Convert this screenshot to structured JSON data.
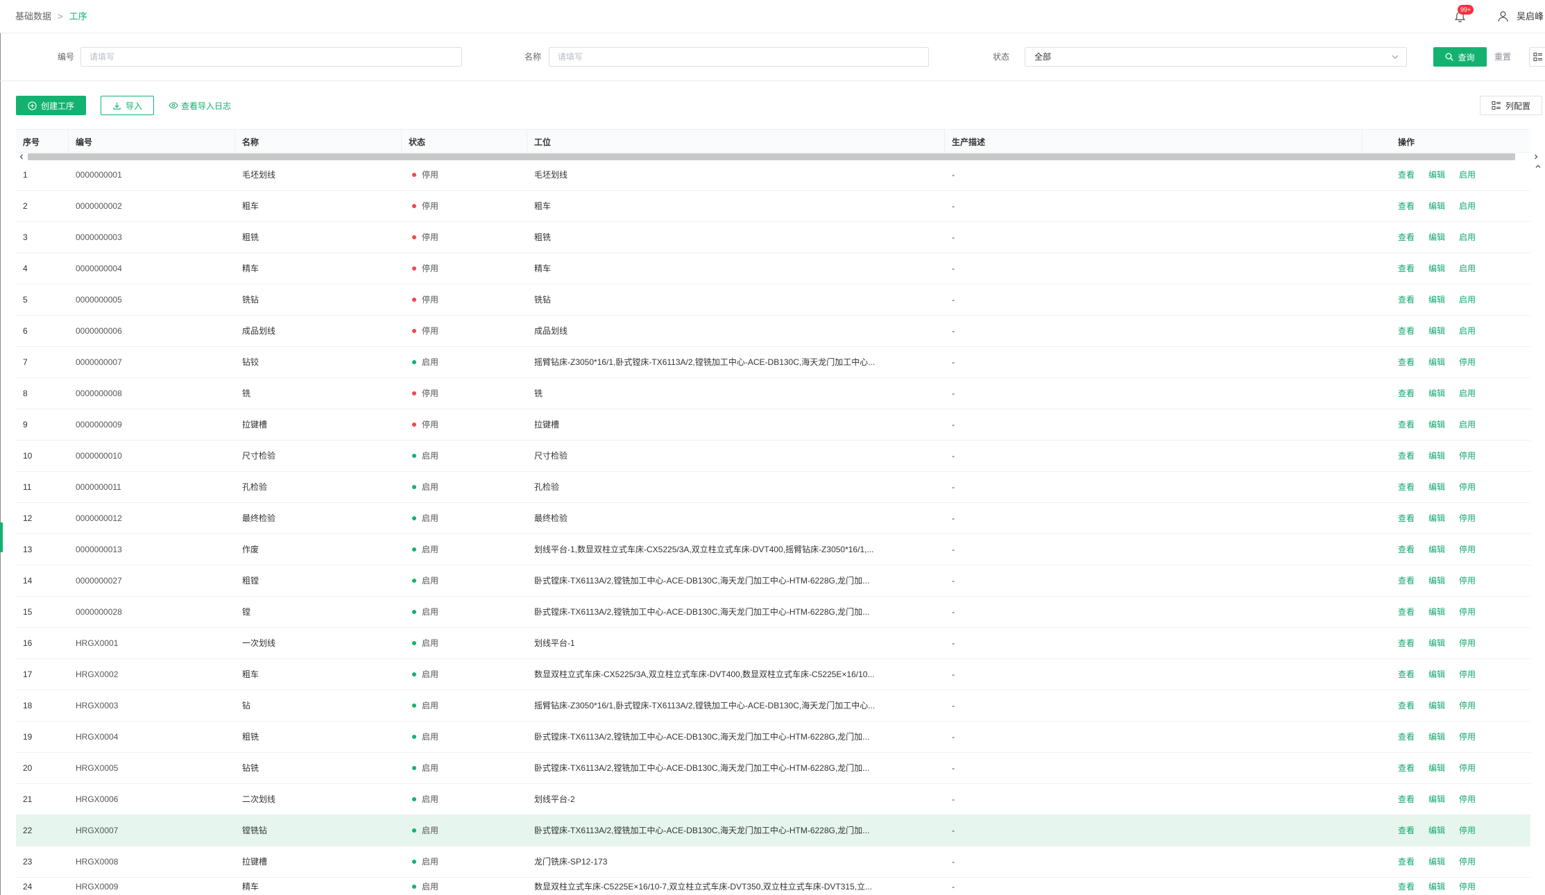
{
  "breadcrumb": {
    "parent": "基础数据",
    "separator": ">",
    "current": "工序"
  },
  "header": {
    "notification_count": "99+",
    "user_name": "吴启峰"
  },
  "filters": {
    "code_label": "编号",
    "code_placeholder": "请填写",
    "name_label": "名称",
    "name_placeholder": "请填写",
    "status_label": "状态",
    "status_value": "全部",
    "query_label": "查询",
    "reset_label": "重置"
  },
  "toolbar": {
    "create_label": "创建工序",
    "import_label": "导入",
    "log_label": "查看导入日志",
    "columns_label": "列配置"
  },
  "colors": {
    "primary": "#13b270",
    "link": "#13a86e",
    "row_highlight": "#e6f6ee",
    "badge": "#f5313d"
  },
  "status_colors": {
    "启用": "#13b270",
    "停用": "#f04848"
  },
  "icons": {
    "notification": "bell-icon",
    "user": "user-icon",
    "query": "search-icon",
    "select": "chevron-down-icon",
    "create": "plus-circle-icon",
    "import": "download-icon",
    "log": "eye-icon",
    "columns": "column-settings-icon"
  },
  "table": {
    "columns": [
      "序号",
      "编号",
      "名称",
      "状态",
      "工位",
      "生产描述",
      "操作"
    ],
    "rows": [
      {
        "no": "1",
        "code": "0000000001",
        "name": "毛坯划线",
        "status": "停用",
        "station": "毛坯划线",
        "desc": "-",
        "actions": [
          "查看",
          "编辑",
          "启用"
        ]
      },
      {
        "no": "2",
        "code": "0000000002",
        "name": "粗车",
        "status": "停用",
        "station": "粗车",
        "desc": "-",
        "actions": [
          "查看",
          "编辑",
          "启用"
        ]
      },
      {
        "no": "3",
        "code": "0000000003",
        "name": "粗铣",
        "status": "停用",
        "station": "粗铣",
        "desc": "-",
        "actions": [
          "查看",
          "编辑",
          "启用"
        ]
      },
      {
        "no": "4",
        "code": "0000000004",
        "name": "精车",
        "status": "停用",
        "station": "精车",
        "desc": "-",
        "actions": [
          "查看",
          "编辑",
          "启用"
        ]
      },
      {
        "no": "5",
        "code": "0000000005",
        "name": "铣钻",
        "status": "停用",
        "station": "铣钻",
        "desc": "-",
        "actions": [
          "查看",
          "编辑",
          "启用"
        ]
      },
      {
        "no": "6",
        "code": "0000000006",
        "name": "成品划线",
        "status": "停用",
        "station": "成品划线",
        "desc": "-",
        "actions": [
          "查看",
          "编辑",
          "启用"
        ]
      },
      {
        "no": "7",
        "code": "0000000007",
        "name": "钻铰",
        "status": "启用",
        "station": "摇臂钻床-Z3050*16/1,卧式镗床-TX6113A/2,镗铣加工中心-ACE-DB130C,海天龙门加工中心...",
        "desc": "-",
        "actions": [
          "查看",
          "编辑",
          "停用"
        ]
      },
      {
        "no": "8",
        "code": "0000000008",
        "name": "铣",
        "status": "停用",
        "station": "铣",
        "desc": "-",
        "actions": [
          "查看",
          "编辑",
          "启用"
        ]
      },
      {
        "no": "9",
        "code": "0000000009",
        "name": "拉键槽",
        "status": "停用",
        "station": "拉键槽",
        "desc": "-",
        "actions": [
          "查看",
          "编辑",
          "启用"
        ]
      },
      {
        "no": "10",
        "code": "0000000010",
        "name": "尺寸检验",
        "status": "启用",
        "station": "尺寸检验",
        "desc": "-",
        "actions": [
          "查看",
          "编辑",
          "停用"
        ]
      },
      {
        "no": "11",
        "code": "0000000011",
        "name": "孔检验",
        "status": "启用",
        "station": "孔检验",
        "desc": "-",
        "actions": [
          "查看",
          "编辑",
          "停用"
        ]
      },
      {
        "no": "12",
        "code": "0000000012",
        "name": "最终检验",
        "status": "启用",
        "station": "最终检验",
        "desc": "-",
        "actions": [
          "查看",
          "编辑",
          "停用"
        ]
      },
      {
        "no": "13",
        "code": "0000000013",
        "name": "作废",
        "status": "启用",
        "station": "划线平台-1,数显双柱立式车床-CX5225/3A,双立柱立式车床-DVT400,摇臂钻床-Z3050*16/1,...",
        "desc": "-",
        "actions": [
          "查看",
          "编辑",
          "停用"
        ]
      },
      {
        "no": "14",
        "code": "0000000027",
        "name": "粗镗",
        "status": "启用",
        "station": "卧式镗床-TX6113A/2,镗铣加工中心-ACE-DB130C,海天龙门加工中心-HTM-6228G,龙门加...",
        "desc": "-",
        "actions": [
          "查看",
          "编辑",
          "停用"
        ]
      },
      {
        "no": "15",
        "code": "0000000028",
        "name": "镗",
        "status": "启用",
        "station": "卧式镗床-TX6113A/2,镗铣加工中心-ACE-DB130C,海天龙门加工中心-HTM-6228G,龙门加...",
        "desc": "-",
        "actions": [
          "查看",
          "编辑",
          "停用"
        ]
      },
      {
        "no": "16",
        "code": "HRGX0001",
        "name": "一次划线",
        "status": "启用",
        "station": "划线平台-1",
        "desc": "-",
        "actions": [
          "查看",
          "编辑",
          "停用"
        ]
      },
      {
        "no": "17",
        "code": "HRGX0002",
        "name": "粗车",
        "status": "启用",
        "station": "数显双柱立式车床-CX5225/3A,双立柱立式车床-DVT400,数显双柱立式车床-C5225E×16/10...",
        "desc": "-",
        "actions": [
          "查看",
          "编辑",
          "停用"
        ]
      },
      {
        "no": "18",
        "code": "HRGX0003",
        "name": "钻",
        "status": "启用",
        "station": "摇臂钻床-Z3050*16/1,卧式镗床-TX6113A/2,镗铣加工中心-ACE-DB130C,海天龙门加工中心...",
        "desc": "-",
        "actions": [
          "查看",
          "编辑",
          "停用"
        ]
      },
      {
        "no": "19",
        "code": "HRGX0004",
        "name": "粗铣",
        "status": "启用",
        "station": "卧式镗床-TX6113A/2,镗铣加工中心-ACE-DB130C,海天龙门加工中心-HTM-6228G,龙门加...",
        "desc": "-",
        "actions": [
          "查看",
          "编辑",
          "停用"
        ]
      },
      {
        "no": "20",
        "code": "HRGX0005",
        "name": "钻铣",
        "status": "启用",
        "station": "卧式镗床-TX6113A/2,镗铣加工中心-ACE-DB130C,海天龙门加工中心-HTM-6228G,龙门加...",
        "desc": "-",
        "actions": [
          "查看",
          "编辑",
          "停用"
        ]
      },
      {
        "no": "21",
        "code": "HRGX0006",
        "name": "二次划线",
        "status": "启用",
        "station": "划线平台-2",
        "desc": "-",
        "actions": [
          "查看",
          "编辑",
          "停用"
        ]
      },
      {
        "no": "22",
        "code": "HRGX0007",
        "name": "镗铣钻",
        "status": "启用",
        "station": "卧式镗床-TX6113A/2,镗铣加工中心-ACE-DB130C,海天龙门加工中心-HTM-6228G,龙门加...",
        "desc": "-",
        "actions": [
          "查看",
          "编辑",
          "停用"
        ],
        "highlighted": true
      },
      {
        "no": "23",
        "code": "HRGX0008",
        "name": "拉键槽",
        "status": "启用",
        "station": "龙门铣床-SP12-173",
        "desc": "-",
        "actions": [
          "查看",
          "编辑",
          "停用"
        ]
      },
      {
        "no": "24",
        "code": "HRGX0009",
        "name": "精车",
        "status": "启用",
        "station": "数显双柱立式车床-C5225E×16/10-7,双立柱立式车床-DVT350,双立柱立式车床-DVT315,立...",
        "desc": "-",
        "actions": [
          "查看",
          "编辑",
          "停用"
        ]
      }
    ]
  }
}
